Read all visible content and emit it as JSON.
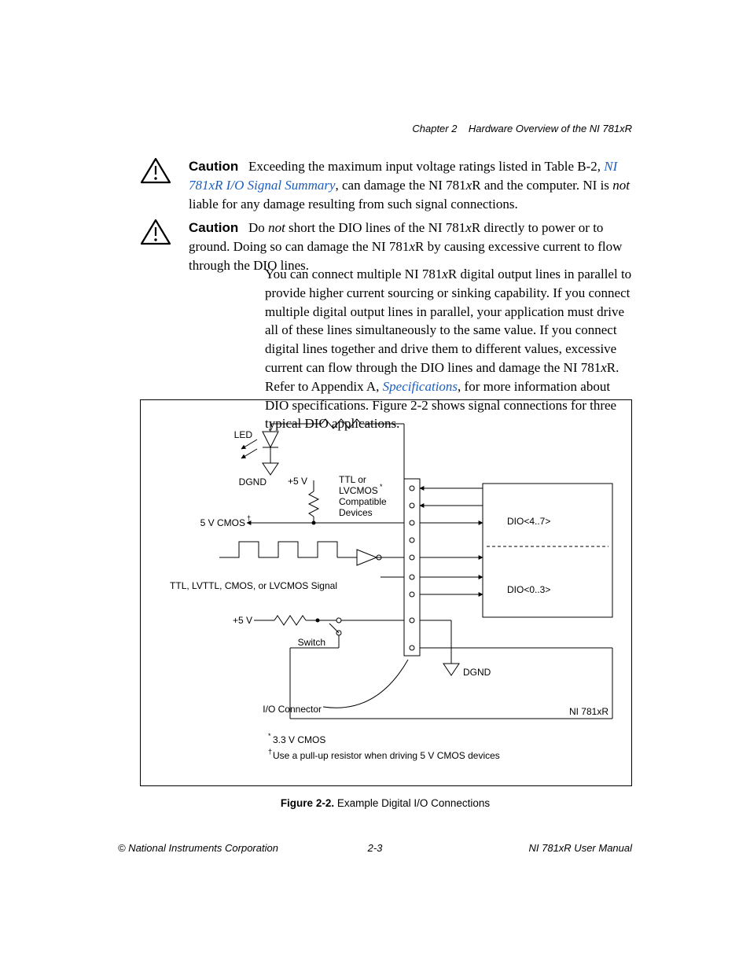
{
  "header": {
    "chapter": "Chapter 2",
    "title": "Hardware Overview of the NI 781xR"
  },
  "cautions": [
    {
      "label": "Caution",
      "text_before_link": "Exceeding the maximum input voltage ratings listed in Table B-2, ",
      "link_text": "NI 781xR I/O Signal Summary",
      "text_after_link_1": ", can damage the NI 781",
      "x1": "x",
      "text_after_link_2": "R and the computer. NI is ",
      "not_text": "not",
      "text_after_not": " liable for any damage resulting from such signal connections."
    },
    {
      "label": "Caution",
      "text_before_not": "Do ",
      "not_text": "not",
      "text_after_not_1": " short the DIO lines of the NI 781",
      "x1": "x",
      "text_after_x1": "R directly to power or to ground. Doing so can damage the NI 781",
      "x2": "x",
      "text_after_x2": "R by causing excessive current to flow through the DIO lines."
    }
  ],
  "body": {
    "p1_a": "You can connect multiple NI 781",
    "p1_x1": "x",
    "p1_b": "R digital output lines in parallel to provide higher current sourcing or sinking capability. If you connect multiple digital output lines in parallel, your application must drive all of these lines simultaneously to the same value. If you connect digital lines together and drive them to different values, excessive current can flow through the DIO lines and damage the NI 781",
    "p1_x2": "x",
    "p1_c": "R. Refer to Appendix A, ",
    "link_text": "Specifications",
    "p1_d": ", for more information about DIO specifications. Figure 2-2 shows signal connections for three typical DIO applications."
  },
  "figure": {
    "caption_bold": "Figure 2-2.",
    "caption_rest": "  Example Digital I/O Connections",
    "labels": {
      "led": "LED",
      "dgnd1": "DGND",
      "plus5v_1": "+5 V",
      "ttl_or": "TTL or",
      "lvcmos": "LVCMOS",
      "compatible": "Compatible",
      "devices": "Devices",
      "cmos5v": "5 V CMOS",
      "ttl_signal": "TTL, LVTTL, CMOS, or LVCMOS Signal",
      "plus5v_2": "+5 V",
      "switch": "Switch",
      "io_connector": "I/O Connector",
      "dgnd2": "DGND",
      "dio47": "DIO<4..7>",
      "dio03": "DIO<0..3>",
      "device": "NI 781xR",
      "note1": "3.3 V CMOS",
      "note2": "Use a pull-up resistor when driving 5 V CMOS devices",
      "star": "*",
      "dagger": "†"
    }
  },
  "footer": {
    "left": "© National Instruments Corporation",
    "center": "2-3",
    "right": "NI 781xR User Manual"
  }
}
